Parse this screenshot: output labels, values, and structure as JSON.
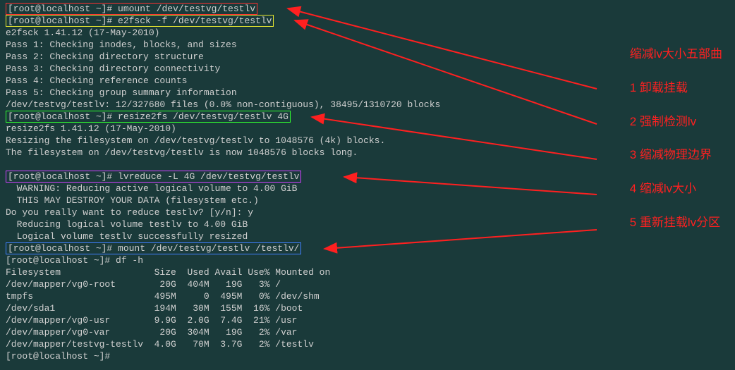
{
  "prompt": "[root@localhost ~]# ",
  "cmd1": "umount /dev/testvg/testlv",
  "cmd2": "e2fsck -f /dev/testvg/testlv",
  "e2fsck": {
    "ver": "e2fsck 1.41.12 (17-May-2010)",
    "p1": "Pass 1: Checking inodes, blocks, and sizes",
    "p2": "Pass 2: Checking directory structure",
    "p3": "Pass 3: Checking directory connectivity",
    "p4": "Pass 4: Checking reference counts",
    "p5": "Pass 5: Checking group summary information",
    "sum": "/dev/testvg/testlv: 12/327680 files (0.0% non-contiguous), 38495/1310720 blocks"
  },
  "cmd3": "resize2fs /dev/testvg/testlv 4G",
  "resize": {
    "ver": "resize2fs 1.41.12 (17-May-2010)",
    "l1": "Resizing the filesystem on /dev/testvg/testlv to 1048576 (4k) blocks.",
    "l2": "The filesystem on /dev/testvg/testlv is now 1048576 blocks long."
  },
  "cmd4": "lvreduce -L 4G /dev/testvg/testlv",
  "lvreduce": {
    "w1": "  WARNING: Reducing active logical volume to 4.00 GiB",
    "w2": "  THIS MAY DESTROY YOUR DATA (filesystem etc.)",
    "q": "Do you really want to reduce testlv? [y/n]: y",
    "r1": "  Reducing logical volume testlv to 4.00 GiB",
    "r2": "  Logical volume testlv successfully resized"
  },
  "cmd5": "mount /dev/testvg/testlv /testlv/",
  "cmd6": "df -h",
  "df": {
    "hdr": "Filesystem                 Size  Used Avail Use% Mounted on",
    "r1": "/dev/mapper/vg0-root        20G  404M   19G   3% /",
    "r2": "tmpfs                      495M     0  495M   0% /dev/shm",
    "r3": "/dev/sda1                  194M   30M  155M  16% /boot",
    "r4": "/dev/mapper/vg0-usr        9.9G  2.0G  7.4G  21% /usr",
    "r5": "/dev/mapper/vg0-var         20G  304M   19G   2% /var",
    "r6": "/dev/mapper/testvg-testlv  4.0G   70M  3.7G   2% /testlv"
  },
  "ann": {
    "title": "缩减lv大小五部曲",
    "s1": "1 卸载挂载",
    "s2": "2 强制检测lv",
    "s3": "3 缩减物理边界",
    "s4": "4 缩减lv大小",
    "s5": "5 重新挂载lv分区"
  },
  "colors": {
    "arrow": "#ff2020"
  }
}
